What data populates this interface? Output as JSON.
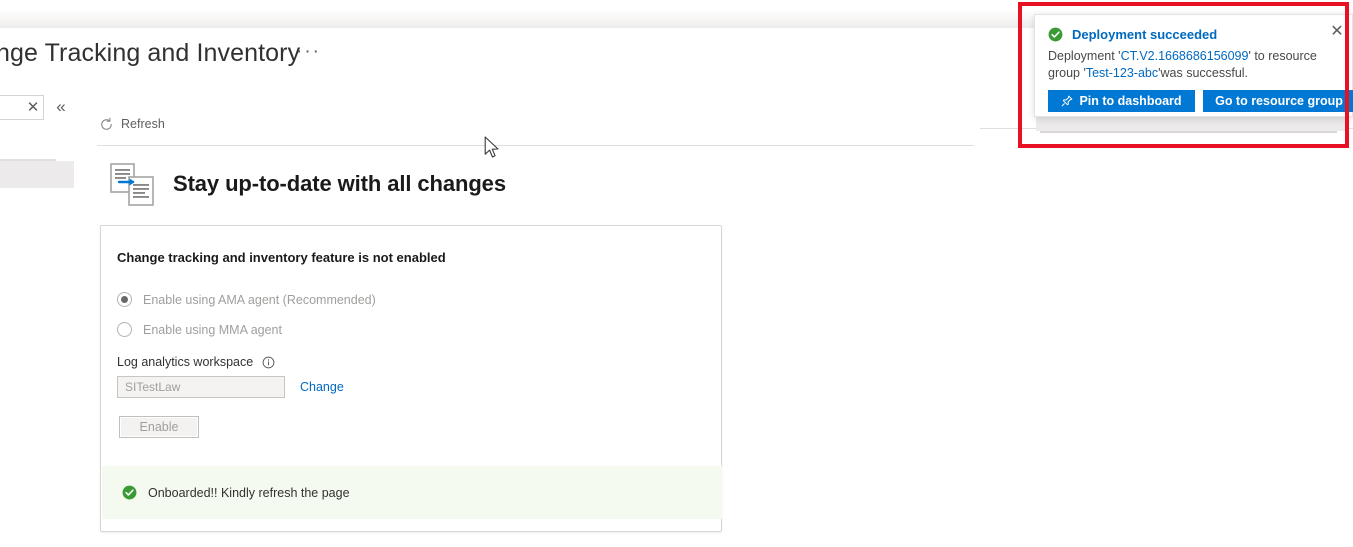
{
  "blade": {
    "title": "ange Tracking and Inventory",
    "context_menu_glyph": "···"
  },
  "rail": {
    "search_clear_glyph": "✕",
    "collapse_glyph": "«"
  },
  "commandbar": {
    "refresh_label": "Refresh",
    "refresh_icon": "refresh-circular-arrow-icon"
  },
  "hero": {
    "icon": "document-change-arrow-icon",
    "title": "Stay up-to-date with all changes"
  },
  "card": {
    "heading": "Change tracking and inventory feature is not enabled",
    "radios": [
      {
        "label": "Enable using AMA agent (Recommended)",
        "checked": true,
        "disabled": true
      },
      {
        "label": "Enable using MMA agent",
        "checked": false,
        "disabled": true
      }
    ],
    "workspace": {
      "label": "Log analytics workspace",
      "info_icon": "info-circle-icon",
      "value": "SITestLaw",
      "placeholder": "SITestLaw",
      "change_link": "Change"
    },
    "enable_button": {
      "label": "Enable",
      "disabled": true
    },
    "banner": {
      "icon": "success-check-circle-icon",
      "text": "Onboarded!! Kindly refresh the page",
      "background": "#f4faf0"
    }
  },
  "toast": {
    "icon": "success-check-circle-icon",
    "title": "Deployment succeeded",
    "close_glyph": "✕",
    "body_prefix": "Deployment '",
    "deployment_name": "CT.V2.1668686156099",
    "body_middle": "' to resource group '",
    "resource_group": "Test-123-abc",
    "body_suffix": "'was successful.",
    "buttons": [
      {
        "label": "Pin to dashboard",
        "icon": "pin-icon"
      },
      {
        "label": "Go to resource group",
        "icon": ""
      }
    ]
  },
  "annotation": {
    "shape": "red-highlight-rectangle",
    "color": "#e81123"
  },
  "colors": {
    "accent_blue": "#0078d4",
    "link_blue": "#0069c0",
    "success_green": "#3a9b35",
    "annotation_red": "#e81123",
    "banner_green_bg": "#f4faf0"
  }
}
